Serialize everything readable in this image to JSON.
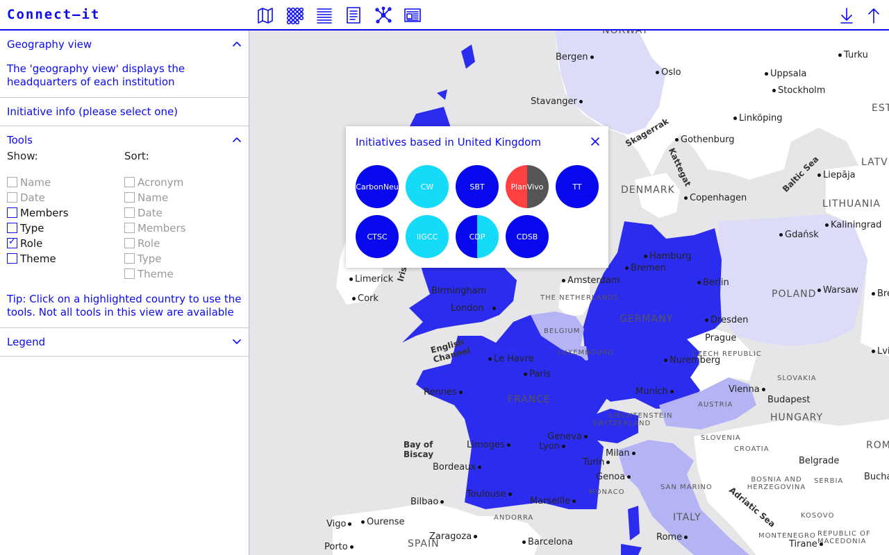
{
  "header": {
    "title": "Connect—it",
    "nav_icons": [
      "map-icon",
      "grid-icon",
      "list-icon",
      "document-icon",
      "network-icon",
      "newspaper-icon"
    ],
    "actions": [
      "download-icon",
      "upload-icon"
    ]
  },
  "sidebar": {
    "geography": {
      "label": "Geography view",
      "text": "The 'geography view' displays the headquarters of each institution"
    },
    "initiative": {
      "label": "Initiative info (please select one)"
    },
    "tools": {
      "label": "Tools",
      "show_label": "Show:",
      "sort_label": "Sort:",
      "show": [
        {
          "label": "Name",
          "state": "disabled"
        },
        {
          "label": "Date",
          "state": "disabled"
        },
        {
          "label": "Members",
          "state": "unchecked"
        },
        {
          "label": "Type",
          "state": "unchecked"
        },
        {
          "label": "Role",
          "state": "checked"
        },
        {
          "label": "Theme",
          "state": "unchecked"
        }
      ],
      "sort": [
        {
          "label": "Acronym",
          "state": "disabled"
        },
        {
          "label": "Name",
          "state": "disabled"
        },
        {
          "label": "Date",
          "state": "disabled"
        },
        {
          "label": "Members",
          "state": "disabled"
        },
        {
          "label": "Role",
          "state": "disabled"
        },
        {
          "label": "Type",
          "state": "disabled"
        },
        {
          "label": "Theme",
          "state": "disabled"
        }
      ],
      "tip": "Tip: Click on a highlighted country to use the tools. Not all tools in this view are available"
    },
    "legend": {
      "label": "Legend"
    }
  },
  "popup": {
    "title": "Initiatives based in United Kingdom",
    "bubbles": [
      {
        "label": "CarbonNeu",
        "colors": [
          "#0808ee"
        ]
      },
      {
        "label": "CW",
        "colors": [
          "#14dcf8"
        ]
      },
      {
        "label": "SBT",
        "colors": [
          "#0808ee"
        ]
      },
      {
        "label": "PlanVivo",
        "colors": [
          "#ff4040",
          "#555555"
        ]
      },
      {
        "label": "TT",
        "colors": [
          "#0808ee"
        ]
      },
      {
        "label": "CTSC",
        "colors": [
          "#0808ee"
        ]
      },
      {
        "label": "IIGCC",
        "colors": [
          "#14dcf8"
        ]
      },
      {
        "label": "CDP",
        "colors": [
          "#0808ee",
          "#14dcf8"
        ]
      },
      {
        "label": "CDSB",
        "colors": [
          "#0808ee"
        ]
      }
    ]
  },
  "map": {
    "colors": {
      "strong": "#2c2cee",
      "light": "#b4b4f4",
      "pale": "#dcdcf8",
      "land": "#ffffff",
      "water": "#e6e6e9"
    },
    "cities": [
      {
        "name": "Bergen"
      },
      {
        "name": "Oslo"
      },
      {
        "name": "Turku"
      },
      {
        "name": "Uppsala"
      },
      {
        "name": "Stockholm"
      },
      {
        "name": "Stavanger"
      },
      {
        "name": "Linköping"
      },
      {
        "name": "Gothenburg"
      },
      {
        "name": "Liepāja"
      },
      {
        "name": "Copenhagen"
      },
      {
        "name": "Kaliningrad"
      },
      {
        "name": "Gdańsk"
      },
      {
        "name": "Hamburg"
      },
      {
        "name": "Bremen"
      },
      {
        "name": "Berlin"
      },
      {
        "name": "Warsaw"
      },
      {
        "name": "Brest"
      },
      {
        "name": "Amsterdam"
      },
      {
        "name": "Limerick"
      },
      {
        "name": "Cork"
      },
      {
        "name": "Birmingham"
      },
      {
        "name": "London"
      },
      {
        "name": "Dresden"
      },
      {
        "name": "Prague"
      },
      {
        "name": "Le Havre"
      },
      {
        "name": "Paris"
      },
      {
        "name": "Nuremberg"
      },
      {
        "name": "Rennes"
      },
      {
        "name": "Munich"
      },
      {
        "name": "Vienna"
      },
      {
        "name": "Budapest"
      },
      {
        "name": "Geneva"
      },
      {
        "name": "Lyon"
      },
      {
        "name": "Limoges"
      },
      {
        "name": "Milan"
      },
      {
        "name": "Turin"
      },
      {
        "name": "Bordeaux"
      },
      {
        "name": "Genoa"
      },
      {
        "name": "Belgrade"
      },
      {
        "name": "Toulouse"
      },
      {
        "name": "Marseille"
      },
      {
        "name": "Bilbao"
      },
      {
        "name": "Vigo"
      },
      {
        "name": "Ourense"
      },
      {
        "name": "Zaragoza"
      },
      {
        "name": "Barcelona"
      },
      {
        "name": "Rome"
      },
      {
        "name": "Porto"
      },
      {
        "name": "Lviv"
      },
      {
        "name": "Tirane"
      }
    ],
    "countries": [
      "NORWAY",
      "DENMARK",
      "EST",
      "LATV",
      "LITHUANIA",
      "POLAND",
      "GERMANY",
      "THE NETHERLANDS",
      "BELGIUM",
      "LUXEMBOURG",
      "CZECH REPUBLIC",
      "FRANCE",
      "SLOVAKIA",
      "AUSTRIA",
      "HUNGARY",
      "LIECHTENSTEIN",
      "SWITZERLAND",
      "SLOVENIA",
      "CROATIA",
      "ROMA",
      "BOSNIA AND HERZEGOVINA",
      "SERBIA",
      "MONACO",
      "SAN MARINO",
      "ITALY",
      "KOSOVO",
      "MONTENEGRO",
      "REPUBLIC OF MACEDONIA",
      "ANDORRA",
      "SPAIN",
      "Bucharest"
    ],
    "seas": [
      "Skagerrak",
      "Kattegat",
      "Baltic Sea",
      "English Channel",
      "Bay of Biscay",
      "Adriatic Sea",
      "Irish"
    ]
  }
}
